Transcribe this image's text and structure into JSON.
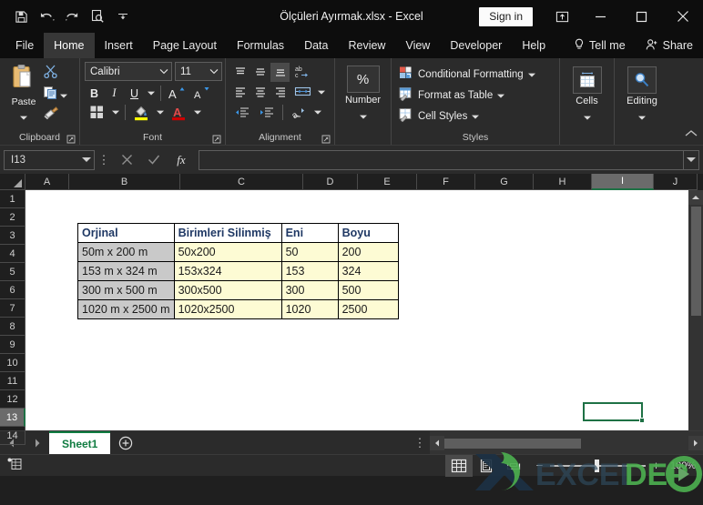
{
  "window": {
    "title": "Ölçüleri Ayırmak.xlsx  -  Excel",
    "signin_label": "Sign in",
    "quick_access": [
      {
        "name": "save-icon",
        "label": "Save"
      },
      {
        "name": "undo-icon",
        "label": "Undo"
      },
      {
        "name": "redo-icon",
        "label": "Redo"
      },
      {
        "name": "print-preview-icon",
        "label": "Print Preview and Print"
      },
      {
        "name": "customize-qat-icon",
        "label": "Customize Quick Access Toolbar"
      }
    ],
    "controls": [
      {
        "name": "ribbon-display-options-icon",
        "label": "Ribbon Display Options"
      },
      {
        "name": "minimize-icon",
        "label": "Minimize"
      },
      {
        "name": "maximize-icon",
        "label": "Maximize"
      },
      {
        "name": "close-icon",
        "label": "Close"
      }
    ]
  },
  "ribbon": {
    "tabs": [
      {
        "label": "File",
        "active": false
      },
      {
        "label": "Home",
        "active": true
      },
      {
        "label": "Insert",
        "active": false
      },
      {
        "label": "Page Layout",
        "active": false
      },
      {
        "label": "Formulas",
        "active": false
      },
      {
        "label": "Data",
        "active": false
      },
      {
        "label": "Review",
        "active": false
      },
      {
        "label": "View",
        "active": false
      },
      {
        "label": "Developer",
        "active": false
      },
      {
        "label": "Help",
        "active": false
      }
    ],
    "tell_me": "Tell me",
    "share": "Share",
    "groups": {
      "clipboard": {
        "label": "Clipboard",
        "paste_label": "Paste",
        "cut_label": "Cut",
        "copy_label": "Copy",
        "format_painter_label": "Format Painter"
      },
      "font": {
        "label": "Font",
        "font_name": "Calibri",
        "font_size": "11",
        "bold": "B",
        "italic": "I",
        "underline": "U",
        "grow_font": "A",
        "shrink_font": "A",
        "borders_label": "Borders",
        "fill_color_label": "Fill Color",
        "font_color_label": "Font Color",
        "fill_color": "#ffff00",
        "font_color": "#cc0000"
      },
      "alignment": {
        "label": "Alignment",
        "wrap_text_label": "Wrap Text",
        "merge_label": "Merge & Center",
        "orientation_label": "Orientation",
        "indent_decrease_label": "Decrease Indent",
        "indent_increase_label": "Increase Indent"
      },
      "number": {
        "label": "Number",
        "button_glyph": "%"
      },
      "styles": {
        "label": "Styles",
        "items": [
          {
            "label": "Conditional Formatting",
            "icon": "conditional-formatting-icon"
          },
          {
            "label": "Format as Table",
            "icon": "format-as-table-icon"
          },
          {
            "label": "Cell Styles",
            "icon": "cell-styles-icon"
          }
        ]
      },
      "cells": {
        "label": "Cells"
      },
      "editing": {
        "label": "Editing"
      }
    }
  },
  "formula_bar": {
    "name_box": "I13",
    "formula_value": "",
    "cancel_label": "Cancel",
    "enter_label": "Enter",
    "function_label": "fx"
  },
  "grid": {
    "columns": [
      "A",
      "B",
      "C",
      "D",
      "E",
      "F",
      "G",
      "H",
      "I",
      "J"
    ],
    "active_column": "I",
    "rows": [
      "1",
      "2",
      "3",
      "4",
      "5",
      "6",
      "7",
      "8",
      "9",
      "10",
      "11",
      "12",
      "13",
      "14"
    ],
    "active_row": "13",
    "active_cell": "I13"
  },
  "table": {
    "headers": [
      "Orjinal",
      "Birimleri Silinmiş",
      "Eni",
      "Boyu"
    ],
    "rows": [
      [
        "50m x 200 m",
        "50x200",
        "50",
        "200"
      ],
      [
        "153 m x 324 m",
        "153x324",
        "153",
        "324"
      ],
      [
        "300 m x 500 m",
        "300x500",
        "300",
        "500"
      ],
      [
        "1020 m x 2500 m",
        "1020x2500",
        "1020",
        "2500"
      ]
    ],
    "header_color": "#1f3864",
    "first_column_fill": "#c9c9c9",
    "data_fill": "#fdfbd4"
  },
  "sheet_tabs": {
    "tabs": [
      {
        "label": "Sheet1",
        "active": true
      }
    ],
    "add_sheet_label": "New sheet",
    "prev_label": "Previous sheet",
    "next_label": "Next sheet"
  },
  "status_bar": {
    "views": [
      {
        "name": "normal-view-icon",
        "label": "Normal",
        "selected": true
      },
      {
        "name": "page-layout-view-icon",
        "label": "Page Layout",
        "selected": false
      },
      {
        "name": "page-break-preview-icon",
        "label": "Page Break Preview",
        "selected": false
      }
    ],
    "zoom_out": "−",
    "zoom_in": "+",
    "zoom_value": "100%"
  },
  "watermark": {
    "text_dark": "EXCEL",
    "text_green": "DEPO",
    "color_dark": "#1c3144",
    "color_green": "#4cae4f"
  }
}
